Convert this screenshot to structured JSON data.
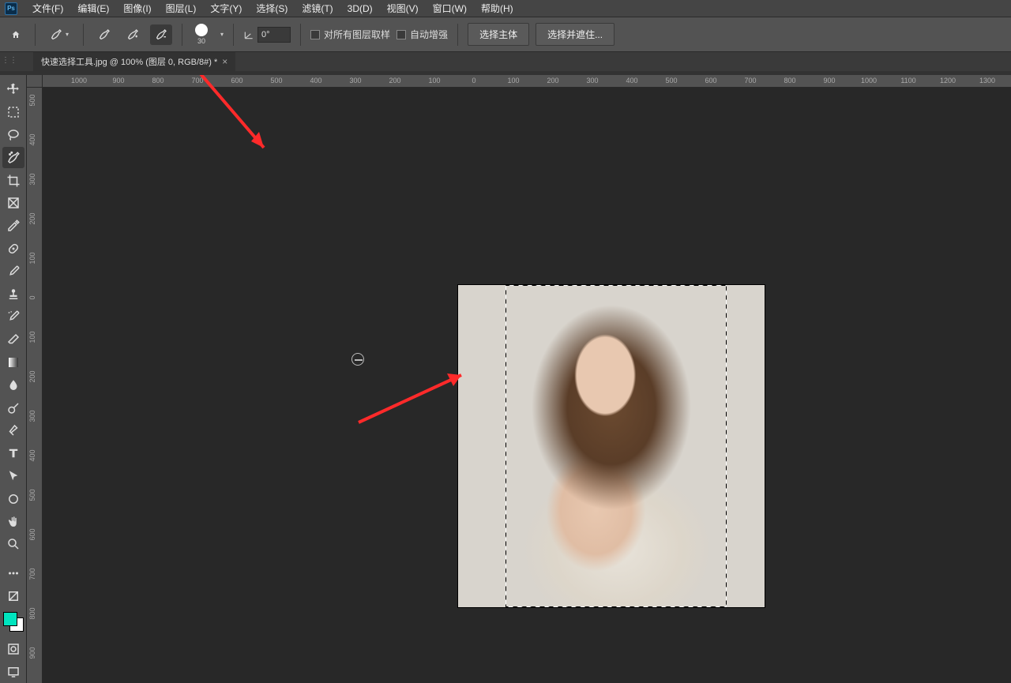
{
  "menus": [
    "文件(F)",
    "编辑(E)",
    "图像(I)",
    "图层(L)",
    "文字(Y)",
    "选择(S)",
    "滤镜(T)",
    "3D(D)",
    "视图(V)",
    "窗口(W)",
    "帮助(H)"
  ],
  "options": {
    "brush_size": "30",
    "angle": "0°",
    "cb_all_layers": "对所有图层取样",
    "cb_auto_enhance": "自动增强",
    "btn_select_subject": "选择主体",
    "btn_select_and_mask": "选择并遮住..."
  },
  "tab": {
    "title": "快速选择工具.jpg @ 100% (图层 0, RGB/8#) *"
  },
  "ruler_h": [
    "1000",
    "900",
    "800",
    "700",
    "600",
    "500",
    "400",
    "300",
    "200",
    "100",
    "0",
    "100",
    "200",
    "300",
    "400",
    "500",
    "600",
    "700",
    "800",
    "900",
    "1000",
    "1100",
    "1200",
    "1300"
  ],
  "ruler_v": [
    "500",
    "400",
    "300",
    "200",
    "100",
    "0",
    "100",
    "200",
    "300",
    "400",
    "500",
    "600",
    "700",
    "800",
    "900"
  ],
  "tools": [
    "move",
    "marquee",
    "lasso",
    "quick-select",
    "crop",
    "frame",
    "eyedropper",
    "heal",
    "brush",
    "stamp",
    "history-brush",
    "eraser",
    "gradient",
    "blur",
    "dodge",
    "pen",
    "type",
    "path-select",
    "shape",
    "hand",
    "zoom",
    "menu",
    "edit-toolbar"
  ]
}
